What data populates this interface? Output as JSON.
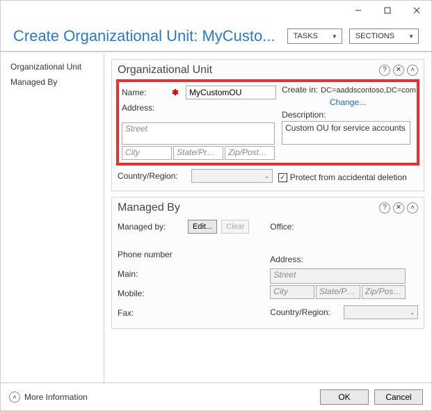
{
  "window": {
    "title": "Create Organizational Unit: MyCusto..."
  },
  "header": {
    "tasks_label": "TASKS",
    "sections_label": "SECTIONS"
  },
  "nav": {
    "item_ou": "Organizational Unit",
    "item_managedby": "Managed By"
  },
  "panels": {
    "ou_title": "Organizational Unit",
    "managedby_title": "Managed By"
  },
  "ou": {
    "name_label": "Name:",
    "name_value": "MyCustomOU",
    "address_label": "Address:",
    "street_placeholder": "Street",
    "city_placeholder": "City",
    "state_placeholder": "State/Provi...",
    "zip_placeholder": "Zip/Postal c...",
    "country_label": "Country/Region:",
    "createin_label": "Create in:",
    "createin_value": "DC=aaddscontoso,DC=com",
    "change_link": "Change...",
    "description_label": "Description:",
    "description_value": "Custom OU for service accounts",
    "protect_label": "Protect from accidental deletion"
  },
  "managed": {
    "managedby_label": "Managed by:",
    "edit_btn": "Edit...",
    "clear_btn": "Clear",
    "phone_label": "Phone number",
    "main_label": "Main:",
    "mobile_label": "Mobile:",
    "fax_label": "Fax:",
    "office_label": "Office:",
    "address_label": "Address:",
    "street_placeholder": "Street",
    "city_placeholder": "City",
    "state_placeholder": "State/Pro...",
    "zip_placeholder": "Zip/Postal...",
    "country_label": "Country/Region:"
  },
  "footer": {
    "more_info": "More Information",
    "ok": "OK",
    "cancel": "Cancel"
  }
}
